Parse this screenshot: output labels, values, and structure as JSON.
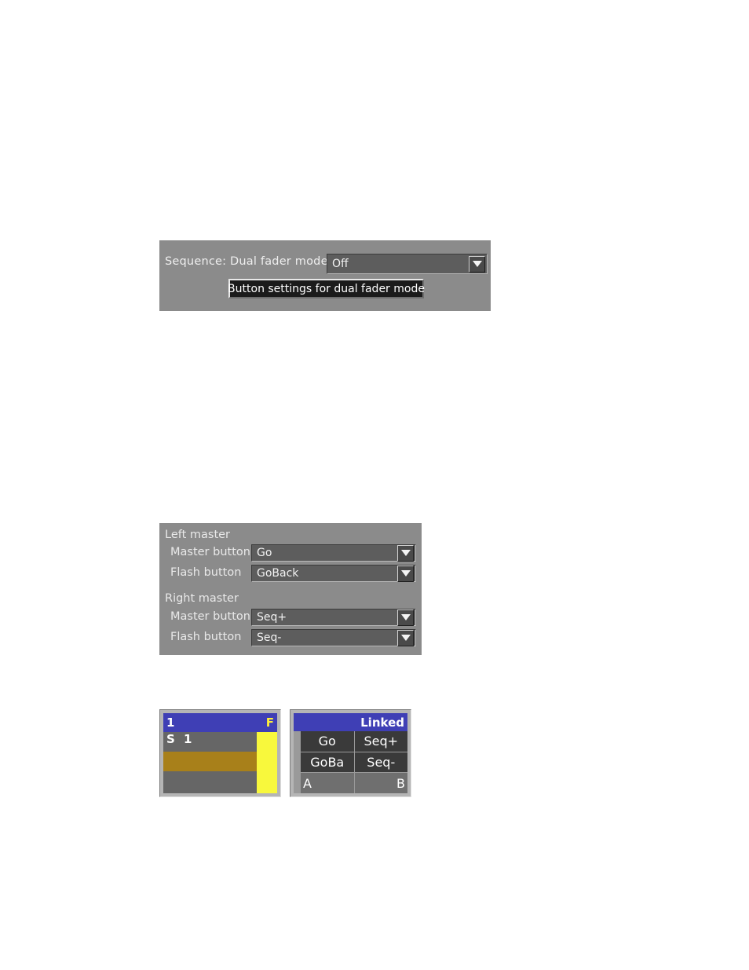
{
  "dual_fader_panel": {
    "label": "Sequence: Dual fader mode",
    "mode_value": "Off",
    "settings_button": "Button settings for dual fader mode"
  },
  "master_buttons_panel": {
    "left_master": {
      "title": "Left master",
      "master_button_label": "Master button",
      "master_button_value": "Go",
      "flash_button_label": "Flash button",
      "flash_button_value": "GoBack"
    },
    "right_master": {
      "title": "Right master",
      "master_button_label": "Master button",
      "master_button_value": "Seq+",
      "flash_button_label": "Flash button",
      "flash_button_value": "Seq-"
    }
  },
  "executor_display": {
    "header_left": "1",
    "header_right": "F",
    "sequence_line": "S  1"
  },
  "linked_display": {
    "header": "Linked",
    "cells": {
      "r1c1": "Go",
      "r1c2": "Seq+",
      "r2c1": "GoBa",
      "r2c2": "Seq-",
      "r3c1": "A",
      "r3c2": "B"
    }
  },
  "colors": {
    "panel_bg": "#8b8b8b",
    "combo_bg": "#5d5d5d",
    "button_bg": "#1b1b1b",
    "display_blue": "#3f3fb5",
    "fader_yellow": "#f8f83c",
    "gold_bar": "#a8801a",
    "display_gray": "#666666"
  }
}
